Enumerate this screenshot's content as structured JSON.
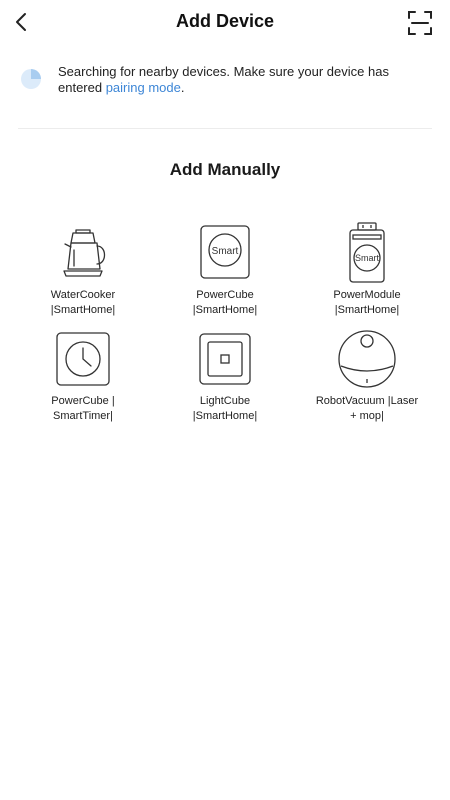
{
  "header": {
    "title": "Add Device"
  },
  "search": {
    "message": "Searching for nearby devices. Make sure your device has entered ",
    "link_text": "pairing mode",
    "suffix": "."
  },
  "section": {
    "title": "Add Manually"
  },
  "devices": [
    {
      "label": "WaterCooker\n|SmartHome|",
      "icon": "kettle-icon",
      "icon_text": ""
    },
    {
      "label": "PowerCube\n|SmartHome|",
      "icon": "smart-plug-icon",
      "icon_text": "Smart"
    },
    {
      "label": "PowerModule\n|SmartHome|",
      "icon": "power-module-icon",
      "icon_text": "Smart"
    },
    {
      "label": "PowerCube |\nSmartTimer|",
      "icon": "timer-plug-icon",
      "icon_text": ""
    },
    {
      "label": "LightCube\n|SmartHome|",
      "icon": "light-switch-icon",
      "icon_text": ""
    },
    {
      "label": "RobotVacuum |Laser\n+ mop|",
      "icon": "robot-vacuum-icon",
      "icon_text": ""
    }
  ],
  "colors": {
    "accent": "#3d86d6",
    "spinner": "#a9cdf0",
    "divider": "#ececec"
  }
}
